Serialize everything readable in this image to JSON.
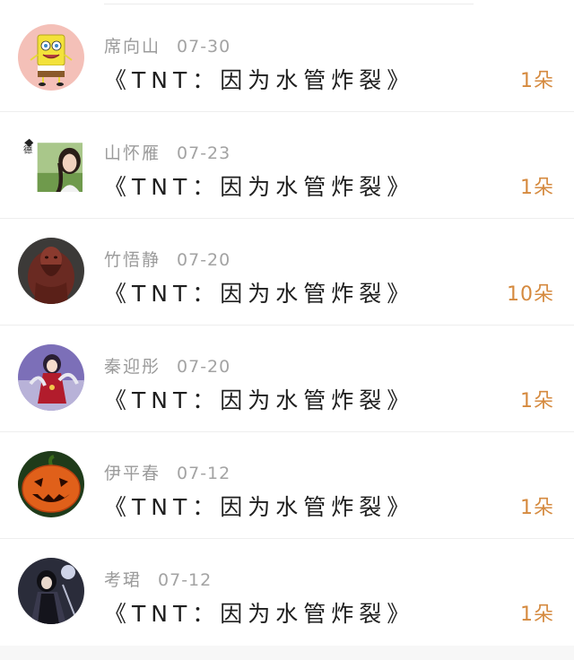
{
  "records": [
    {
      "name": "席向山",
      "date": "07-30",
      "gift": "《TNT：因为水管炸裂》",
      "count": "1朵",
      "avatar_icon": "spongebob-avatar-icon"
    },
    {
      "name": "山怀雁",
      "date": "07-23",
      "gift": "《TNT：因为水管炸裂》",
      "count": "1朵",
      "avatar_icon": "girl-photo-avatar-icon"
    },
    {
      "name": "竹悟静",
      "date": "07-20",
      "gift": "《TNT：因为水管炸裂》",
      "count": "10朵",
      "avatar_icon": "statue-avatar-icon"
    },
    {
      "name": "秦迎彤",
      "date": "07-20",
      "gift": "《TNT：因为水管炸裂》",
      "count": "1朵",
      "avatar_icon": "anime-girl-avatar-icon"
    },
    {
      "name": "伊平春",
      "date": "07-12",
      "gift": "《TNT：因为水管炸裂》",
      "count": "1朵",
      "avatar_icon": "pumpkin-avatar-icon"
    },
    {
      "name": "考珺",
      "date": "07-12",
      "gift": "《TNT：因为水管炸裂》",
      "count": "1朵",
      "avatar_icon": "anime-warrior-avatar-icon"
    }
  ],
  "colors": {
    "name_gray": "#9b9b9b",
    "title_black": "#1f1f1f",
    "count_orange": "#d58a3f",
    "divider": "#eeeeee"
  }
}
